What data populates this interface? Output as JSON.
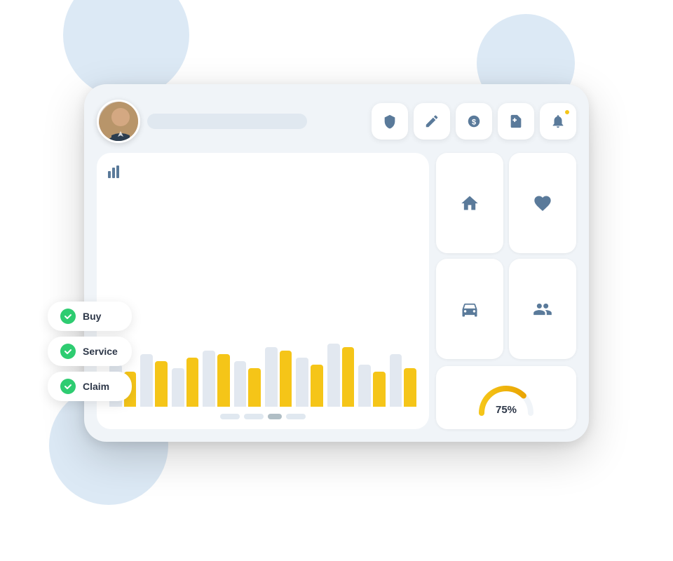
{
  "decorative": {
    "circles": [
      "top-left",
      "top-right",
      "bottom-left"
    ]
  },
  "header": {
    "name_placeholder": "",
    "action_buttons": [
      {
        "id": "shield",
        "label": "Shield",
        "icon": "shield",
        "has_notification": false
      },
      {
        "id": "edit",
        "label": "Edit",
        "icon": "pencil",
        "has_notification": false
      },
      {
        "id": "dollar",
        "label": "Payment",
        "icon": "dollar",
        "has_notification": false
      },
      {
        "id": "file-add",
        "label": "Add File",
        "icon": "file-plus",
        "has_notification": false
      },
      {
        "id": "bell",
        "label": "Notifications",
        "icon": "bell",
        "has_notification": true
      }
    ]
  },
  "chart": {
    "title_icon": "bar-chart",
    "bars": [
      {
        "gray": 60,
        "yellow": 50
      },
      {
        "gray": 75,
        "yellow": 65
      },
      {
        "gray": 55,
        "yellow": 70
      },
      {
        "gray": 80,
        "yellow": 75
      },
      {
        "gray": 65,
        "yellow": 55
      },
      {
        "gray": 85,
        "yellow": 80
      },
      {
        "gray": 70,
        "yellow": 60
      },
      {
        "gray": 90,
        "yellow": 85
      },
      {
        "gray": 60,
        "yellow": 50
      },
      {
        "gray": 75,
        "yellow": 55
      }
    ],
    "dots": [
      {
        "active": false
      },
      {
        "active": false
      },
      {
        "active": true
      },
      {
        "active": false
      }
    ]
  },
  "insurance_types": [
    {
      "id": "home",
      "label": "Home",
      "icon": "home"
    },
    {
      "id": "health",
      "label": "Health",
      "icon": "heart"
    },
    {
      "id": "auto",
      "label": "Auto",
      "icon": "car"
    },
    {
      "id": "life",
      "label": "Life",
      "icon": "family"
    }
  ],
  "gauge": {
    "value": 75,
    "label": "75%",
    "color_start": "#f5c518",
    "color_end": "#e8a000",
    "track_color": "#f0f4f8"
  },
  "legend": [
    {
      "id": "buy",
      "label": "Buy",
      "checked": true
    },
    {
      "id": "service",
      "label": "Service",
      "checked": true
    },
    {
      "id": "claim",
      "label": "Claim",
      "checked": true
    }
  ],
  "colors": {
    "accent": "#f5c518",
    "green": "#2ecc71",
    "blue_gray": "#5a7a9a",
    "bg": "#f0f4f8",
    "card": "#ffffff"
  }
}
